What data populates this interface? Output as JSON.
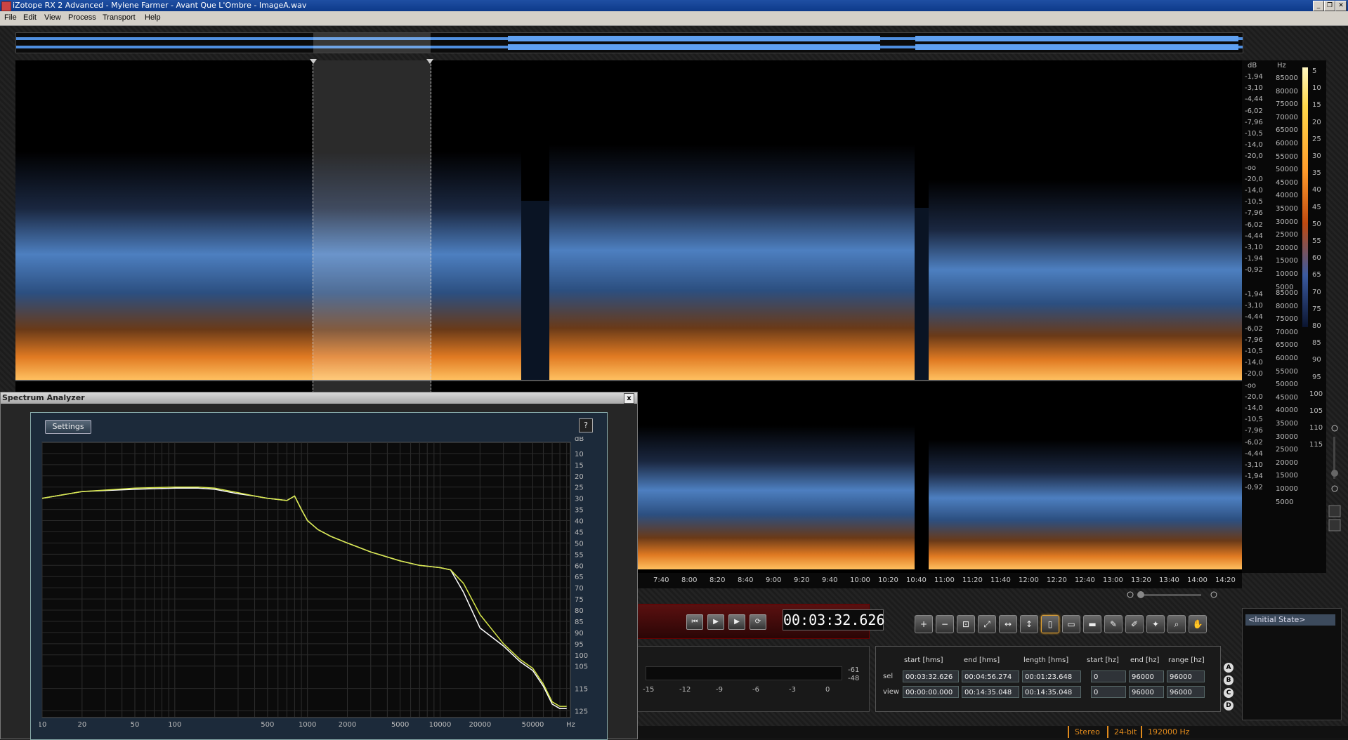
{
  "window": {
    "title": "iZotope RX 2 Advanced - Mylene Farmer - Avant Que L'Ombre - ImageA.wav",
    "controls": [
      "minimize",
      "restore",
      "close"
    ]
  },
  "menu": [
    "File",
    "Edit",
    "View",
    "Process",
    "Transport",
    "Help"
  ],
  "spectrogram": {
    "db_unit": "dB",
    "hz_unit": "Hz",
    "db_labels": [
      "-1,94",
      "-3,10",
      "-4,44",
      "-6,02",
      "-7,96",
      "-10,5",
      "-14,0",
      "-20,0",
      "-oo",
      "-20,0",
      "-14,0",
      "-10,5",
      "-7,96",
      "-6,02",
      "-4,44",
      "-3,10",
      "-1,94",
      "-0,92"
    ],
    "hz_labels": [
      "85000",
      "80000",
      "75000",
      "70000",
      "65000",
      "60000",
      "55000",
      "50000",
      "45000",
      "40000",
      "35000",
      "30000",
      "25000",
      "20000",
      "15000",
      "10000",
      "5000"
    ],
    "colorbar_labels": [
      "5",
      "10",
      "15",
      "20",
      "25",
      "30",
      "35",
      "40",
      "45",
      "50",
      "55",
      "60",
      "65",
      "70",
      "75",
      "80",
      "85",
      "90",
      "95",
      "100",
      "105",
      "110",
      "115"
    ],
    "time_labels": [
      "7:40",
      "8:00",
      "8:20",
      "8:40",
      "9:00",
      "9:20",
      "9:40",
      "10:00",
      "10:20",
      "10:40",
      "11:00",
      "11:20",
      "11:40",
      "12:00",
      "12:20",
      "12:40",
      "13:00",
      "13:20",
      "13:40",
      "14:00",
      "14:20"
    ]
  },
  "transport": {
    "buttons": [
      "skip-to-start",
      "play",
      "play-selection",
      "loop"
    ],
    "time": "00:03:32.626"
  },
  "tools": [
    "zoom-in",
    "zoom-out",
    "zoom-selection",
    "zoom-fit",
    "zoom-time",
    "zoom-frequency",
    "time-select",
    "rect-select",
    "freq-select",
    "lasso-select",
    "brush-select",
    "wand-select",
    "magnify",
    "hand"
  ],
  "meter": {
    "scale": [
      "-15",
      "-12",
      "-9",
      "-6",
      "-3",
      "0"
    ],
    "peak_values": [
      "-61",
      "-48"
    ]
  },
  "selection": {
    "headers": [
      "start [hms]",
      "end [hms]",
      "length [hms]",
      "start [hz]",
      "end [hz]",
      "range [hz]"
    ],
    "rows": [
      {
        "label": "sel",
        "values": [
          "00:03:32.626",
          "00:04:56.274",
          "00:01:23.648",
          "0",
          "96000",
          "96000"
        ]
      },
      {
        "label": "view",
        "values": [
          "00:00:00.000",
          "00:14:35.048",
          "00:14:35.048",
          "0",
          "96000",
          "96000"
        ]
      }
    ],
    "ab_buttons": [
      "A",
      "B",
      "C",
      "D"
    ]
  },
  "history": {
    "items": [
      "<Initial State>"
    ]
  },
  "status": [
    "Stereo",
    "24-bit",
    "192000 Hz"
  ],
  "spectrum_analyzer": {
    "title": "Spectrum Analyzer",
    "close_label": "x",
    "settings_label": "Settings",
    "help_label": "?",
    "db_unit": "dB",
    "hz_unit": "Hz",
    "y_ticks": [
      "10",
      "15",
      "20",
      "25",
      "30",
      "35",
      "40",
      "45",
      "50",
      "55",
      "60",
      "65",
      "70",
      "75",
      "80",
      "85",
      "90",
      "95",
      "100",
      "105",
      "115",
      "125"
    ],
    "x_ticks": [
      "10",
      "20",
      "50",
      "100",
      "500",
      "1000",
      "2000",
      "5000",
      "10000",
      "20000",
      "50000"
    ],
    "accent_colors": {
      "average": "#d8e84a",
      "peak": "#ffffff"
    }
  },
  "chart_data": {
    "type": "line",
    "xscale": "log",
    "xlim": [
      10,
      96000
    ],
    "ylim": [
      5,
      128
    ],
    "xlabel": "Hz",
    "ylabel": "dB",
    "series": [
      {
        "x": [
          10,
          20,
          50,
          100,
          150,
          200,
          300,
          400,
          500,
          700,
          800,
          900,
          1000,
          1200,
          1500,
          2000,
          3000,
          5000,
          7000,
          10000,
          12000,
          15000,
          20000,
          30000,
          40000,
          50000,
          60000,
          70000,
          80000,
          90000
        ],
        "values": [
          30,
          27,
          26,
          25.5,
          25.5,
          26,
          28,
          29,
          30,
          31,
          29,
          35,
          40,
          44,
          47,
          50,
          54,
          58,
          60,
          61,
          62,
          72,
          88,
          96,
          103,
          107,
          114,
          122,
          124,
          124
        ]
      },
      {
        "x": [
          10,
          20,
          50,
          100,
          150,
          200,
          300,
          400,
          500,
          700,
          800,
          900,
          1000,
          1200,
          1500,
          2000,
          3000,
          5000,
          7000,
          10000,
          12000,
          15000,
          20000,
          30000,
          40000,
          50000,
          60000,
          70000,
          80000,
          90000
        ],
        "values": [
          30,
          27,
          25.5,
          25,
          25,
          25.5,
          27.5,
          29,
          30,
          31,
          29,
          35,
          40,
          44,
          47,
          50,
          54,
          58,
          60,
          61,
          62,
          68,
          82,
          95,
          102,
          106,
          113,
          121,
          123,
          123
        ]
      }
    ]
  }
}
